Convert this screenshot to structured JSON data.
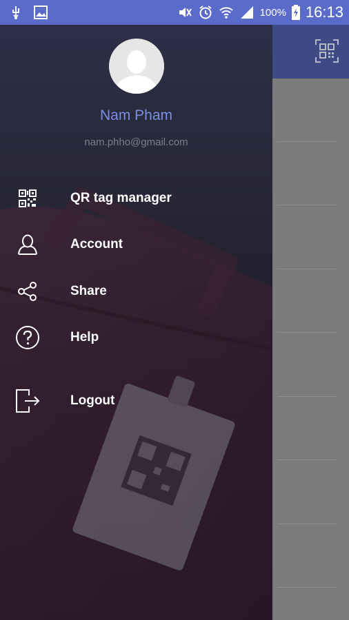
{
  "status_bar": {
    "battery": "100%",
    "time": "16:13",
    "icons": [
      "usb-icon",
      "image-icon",
      "mute-icon",
      "alarm-icon",
      "wifi-icon",
      "signal-icon",
      "battery-charging-icon"
    ]
  },
  "colors": {
    "status_bar": "#5b6bc9",
    "app_header": "#3d4a86",
    "accent_name": "#7c8fe6",
    "email_text": "#7e7f8c"
  },
  "profile": {
    "name": "Nam Pham",
    "email": "nam.phho@gmail.com"
  },
  "menu": {
    "items": [
      {
        "label": "QR tag manager",
        "icon": "qr-code-icon"
      },
      {
        "label": "Account",
        "icon": "user-icon"
      },
      {
        "label": "Share",
        "icon": "share-icon"
      },
      {
        "label": "Help",
        "icon": "help-icon"
      },
      {
        "label": "Logout",
        "icon": "logout-icon"
      }
    ]
  }
}
